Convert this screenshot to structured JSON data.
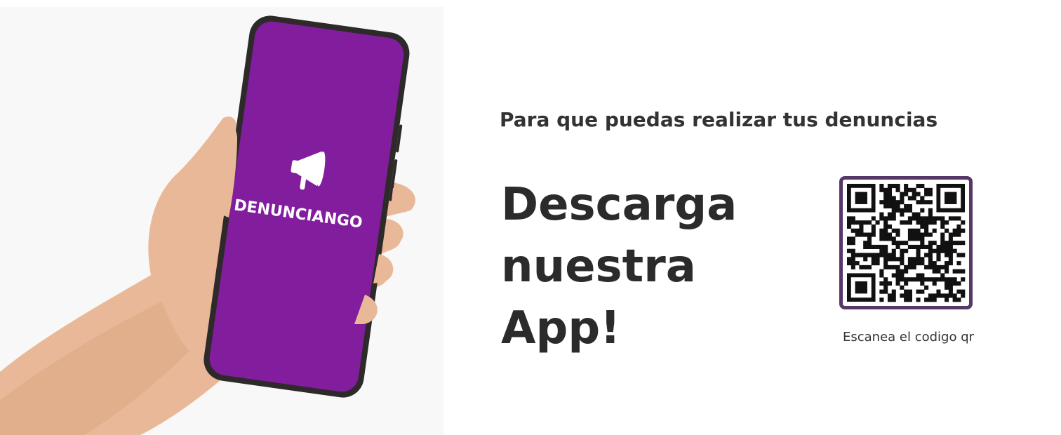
{
  "hero": {
    "app_name": "DENUNCIANGO",
    "phone_screen_color": "#821e9e",
    "icon": "megaphone-icon"
  },
  "content": {
    "subtitle": "Para que puedas realizar tus denuncias",
    "headline_line1": "Descarga",
    "headline_line2": "nuestra",
    "headline_line3": "App!"
  },
  "qr": {
    "caption": "Escanea el codigo qr",
    "border_color": "#573767",
    "icon": "qr-code-icon"
  }
}
